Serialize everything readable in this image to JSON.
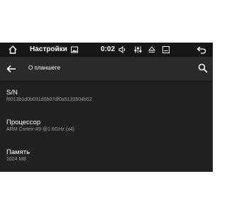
{
  "status_bar": {
    "title": "Настройки",
    "time": "0:02",
    "icons": [
      "home-icon",
      "gallery-icon",
      "volume-icon",
      "sliders-icon",
      "eject-icon",
      "minimize-icon",
      "back-arrow-icon"
    ]
  },
  "app_bar": {
    "title": "О планшете",
    "icons": [
      "arrow-back-icon",
      "search-icon"
    ]
  },
  "items": [
    {
      "title": "S/N",
      "value": "f8013b1d0b031d0b07df0a5133504b52"
    },
    {
      "title": "Процессор",
      "value": "ARM Cortex-A9 @1.6GHz (x4)"
    },
    {
      "title": "Память",
      "value": "1024 MB"
    }
  ],
  "colors": {
    "background": "#212121",
    "status_bar": "#161616",
    "app_bar": "#2a2a2a",
    "primary_text": "#ffffff",
    "secondary_text": "#9e9e9e"
  }
}
